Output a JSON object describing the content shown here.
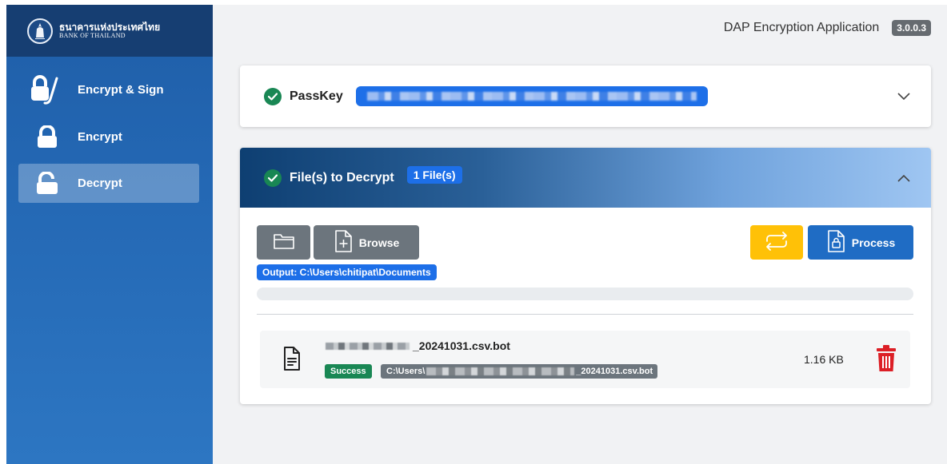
{
  "brand": {
    "thai_name": "ธนาคารแห่งประเทศไทย",
    "english_name": "BANK OF THAILAND"
  },
  "header": {
    "app_title": "DAP Encryption Application",
    "version": "3.0.0.3"
  },
  "sidebar": {
    "items": [
      {
        "label": "Encrypt & Sign",
        "icon": "lock-sign-icon",
        "active": false
      },
      {
        "label": "Encrypt",
        "icon": "lock-icon",
        "active": false
      },
      {
        "label": "Decrypt",
        "icon": "unlock-icon",
        "active": true
      }
    ]
  },
  "passkey": {
    "label": "PassKey",
    "status": "success",
    "value_redacted": true
  },
  "files": {
    "title": "File(s) to Decrypt",
    "count_label": "1 File(s)",
    "browse_label": "Browse",
    "process_label": "Process",
    "output_label": "Output: C:\\Users\\chitipat\\Documents",
    "progress": 0,
    "items": [
      {
        "name_suffix": "_20241031.csv.bot",
        "status": "Success",
        "path_prefix": "C:\\Users\\",
        "path_suffix": "_20241031.csv.bot",
        "size": "1.16 KB"
      }
    ]
  },
  "colors": {
    "primary": "#1d6fe8",
    "success": "#198754",
    "secondary": "#6c757d",
    "warning": "#ffc107",
    "danger": "#dc1f26",
    "sidebar": "#2468b4"
  }
}
